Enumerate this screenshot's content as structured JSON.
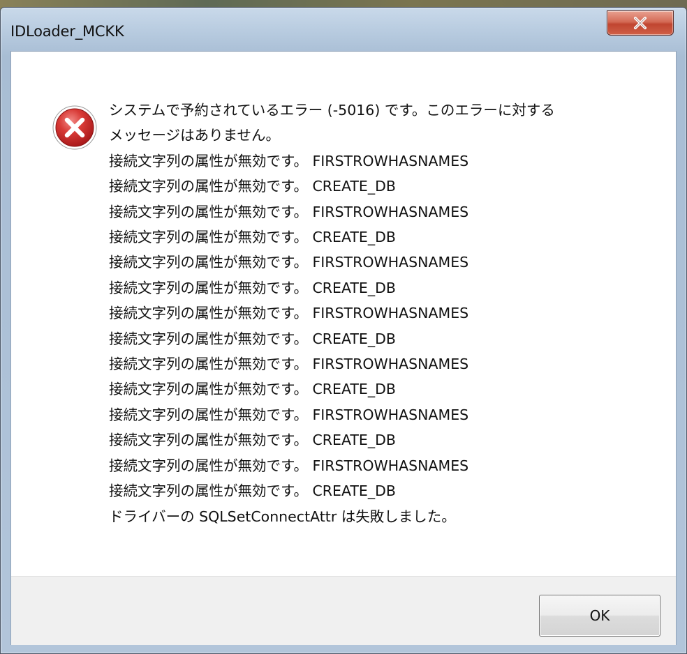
{
  "window": {
    "title": "IDLoader_MCKK"
  },
  "titlebar": {
    "close_icon": "close-icon"
  },
  "dialog": {
    "icon": "error-icon",
    "lines": [
      "システムで予約されているエラー (-5016) です。このエラーに対する",
      "メッセージはありません。",
      "接続文字列の属性が無効です。 FIRSTROWHASNAMES",
      "接続文字列の属性が無効です。 CREATE_DB",
      "接続文字列の属性が無効です。 FIRSTROWHASNAMES",
      "接続文字列の属性が無効です。 CREATE_DB",
      "接続文字列の属性が無効です。 FIRSTROWHASNAMES",
      "接続文字列の属性が無効です。 CREATE_DB",
      "接続文字列の属性が無効です。 FIRSTROWHASNAMES",
      "接続文字列の属性が無効です。 CREATE_DB",
      "接続文字列の属性が無効です。 FIRSTROWHASNAMES",
      "接続文字列の属性が無効です。 CREATE_DB",
      "接続文字列の属性が無効です。 FIRSTROWHASNAMES",
      "接続文字列の属性が無効です。 CREATE_DB",
      "接続文字列の属性が無効です。 FIRSTROWHASNAMES",
      "接続文字列の属性が無効です。 CREATE_DB",
      "ドライバーの SQLSetConnectAttr は失敗しました。"
    ]
  },
  "buttons": {
    "ok_label": "OK"
  },
  "colors": {
    "error_red": "#c8282a",
    "close_red": "#c04530",
    "footer_bg": "#f0f0f0"
  }
}
